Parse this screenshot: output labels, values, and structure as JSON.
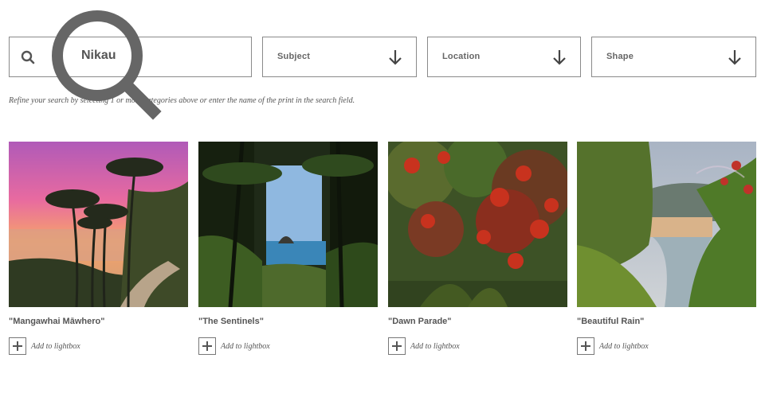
{
  "search": {
    "query": "Nikau"
  },
  "filters": [
    {
      "label": "Subject"
    },
    {
      "label": "Location"
    },
    {
      "label": "Shape"
    }
  ],
  "hint": "Refine your search by selecting 1 or more categories above or enter the name of the print in the search field.",
  "prints": [
    {
      "title": "\"Mangawhai Māwhero\"",
      "action": "Add to lightbox"
    },
    {
      "title": "\"The Sentinels\"",
      "action": "Add to lightbox"
    },
    {
      "title": "\"Dawn Parade\"",
      "action": "Add to lightbox"
    },
    {
      "title": "\"Beautiful Rain\"",
      "action": "Add to lightbox"
    }
  ],
  "icons": {
    "search": "search-icon",
    "magnifier_overlay": "magnifier-icon",
    "select_arrow": "arrow-down-icon",
    "add": "plus-icon"
  },
  "colors": {
    "border": "#8a8a8a",
    "text": "#555555",
    "magnifier": "#666666"
  }
}
